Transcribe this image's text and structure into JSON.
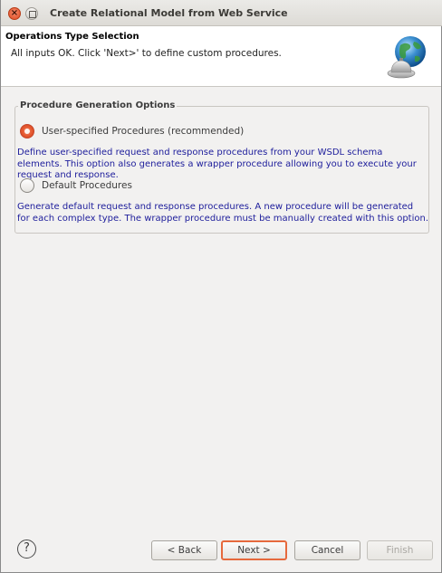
{
  "window": {
    "title": "Create Relational Model from Web Service"
  },
  "banner": {
    "title": "Operations Type Selection",
    "message": "All inputs OK. Click 'Next>' to define custom procedures."
  },
  "group": {
    "legend": "Procedure Generation Options",
    "options": [
      {
        "label": "User-specified Procedures (recommended)",
        "checked": true,
        "description": "Define user-specified request and response procedures from your WSDL schema elements. This option also generates a wrapper procedure allowing you to execute your request and response."
      },
      {
        "label": "Default Procedures",
        "checked": false,
        "description": "Generate default request and response procedures. A new procedure will be generated for each complex type. The wrapper procedure must be manually created with this option."
      }
    ]
  },
  "footer": {
    "help_glyph": "?",
    "back_label": "< Back",
    "next_label": "Next >",
    "cancel_label": "Cancel",
    "finish_label": "Finish"
  },
  "colors": {
    "accent": "#e4572e",
    "description_text": "#1d1d9b",
    "dialog_bg": "#f2f1f0"
  }
}
